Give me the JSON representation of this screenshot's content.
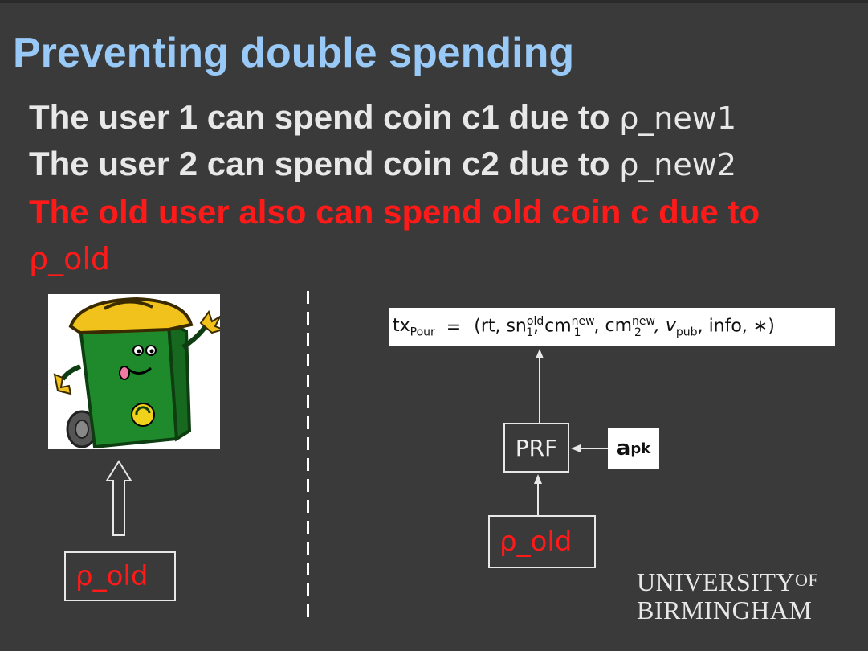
{
  "slide": {
    "title": "Preventing double spending",
    "lines": [
      {
        "text": "The user 1 can spend coin c1 due to ",
        "rho": "ρ_new1"
      },
      {
        "text": "The user 2 can spend coin c2 due to ",
        "rho": "ρ_new2"
      },
      {
        "text": "The old user also can spend old coin c due to"
      }
    ],
    "rho_old_line": "ρ_old"
  },
  "left_diagram": {
    "image": "trash-bin-cartoon",
    "box_label": "ρ_old"
  },
  "right_diagram": {
    "formula": {
      "lhs": "tx",
      "lhs_sub": "Pour",
      "equals": "=",
      "open": "(rt, sn",
      "sn_sup": "old",
      "sn_sub": "1",
      "cm1": ", cm",
      "cm1_sup": "new",
      "cm1_sub": "1",
      "cm2": ", cm",
      "cm2_sup": "new",
      "cm2_sub": "2",
      "v": ", v",
      "v_sub": "pub",
      "close": ", info, ∗)"
    },
    "prf_label": "PRF",
    "apk_label": "a",
    "apk_sub": "pk",
    "box_label": "ρ_old"
  },
  "logo": {
    "line1": "UNIVERSITY",
    "of": "OF",
    "line2": "BIRMINGHAM"
  },
  "colors": {
    "background": "#3a3a3a",
    "title": "#99c9f7",
    "text": "#e8e8e8",
    "highlight": "#ff1a1a"
  }
}
